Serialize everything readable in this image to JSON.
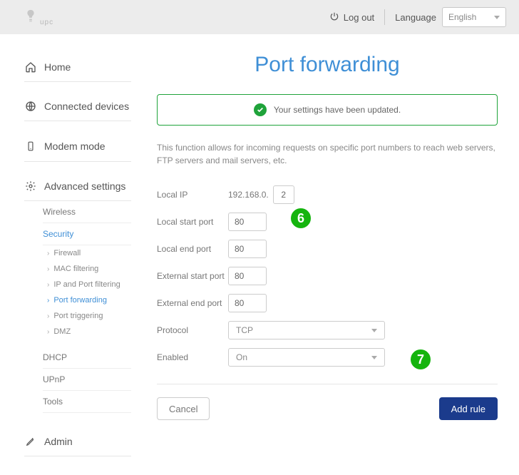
{
  "topbar": {
    "brand": "upc",
    "logout": "Log out",
    "language_label": "Language",
    "language_value": "English"
  },
  "sidebar": {
    "home": "Home",
    "connected": "Connected devices",
    "modem": "Modem mode",
    "advanced": "Advanced settings",
    "wireless": "Wireless",
    "security": "Security",
    "security_items": {
      "firewall": "Firewall",
      "mac": "MAC filtering",
      "ipport": "IP and Port filtering",
      "portfwd": "Port forwarding",
      "porttrig": "Port triggering",
      "dmz": "DMZ"
    },
    "dhcp": "DHCP",
    "upnp": "UPnP",
    "tools": "Tools",
    "admin": "Admin"
  },
  "page": {
    "title": "Port forwarding",
    "alert": "Your settings have been updated.",
    "desc": "This function allows for incoming requests on specific port numbers to reach web servers, FTP servers and mail servers, etc.",
    "labels": {
      "local_ip": "Local IP",
      "local_start": "Local start port",
      "local_end": "Local end port",
      "ext_start": "External start port",
      "ext_end": "External end port",
      "protocol": "Protocol",
      "enabled": "Enabled"
    },
    "values": {
      "ip_prefix": "192.168.0.",
      "ip_last": "2",
      "local_start": "80",
      "local_end": "80",
      "ext_start": "80",
      "ext_end": "80",
      "protocol": "TCP",
      "enabled": "On"
    },
    "buttons": {
      "cancel": "Cancel",
      "add": "Add rule"
    }
  },
  "annotations": {
    "six": "6",
    "seven": "7"
  }
}
